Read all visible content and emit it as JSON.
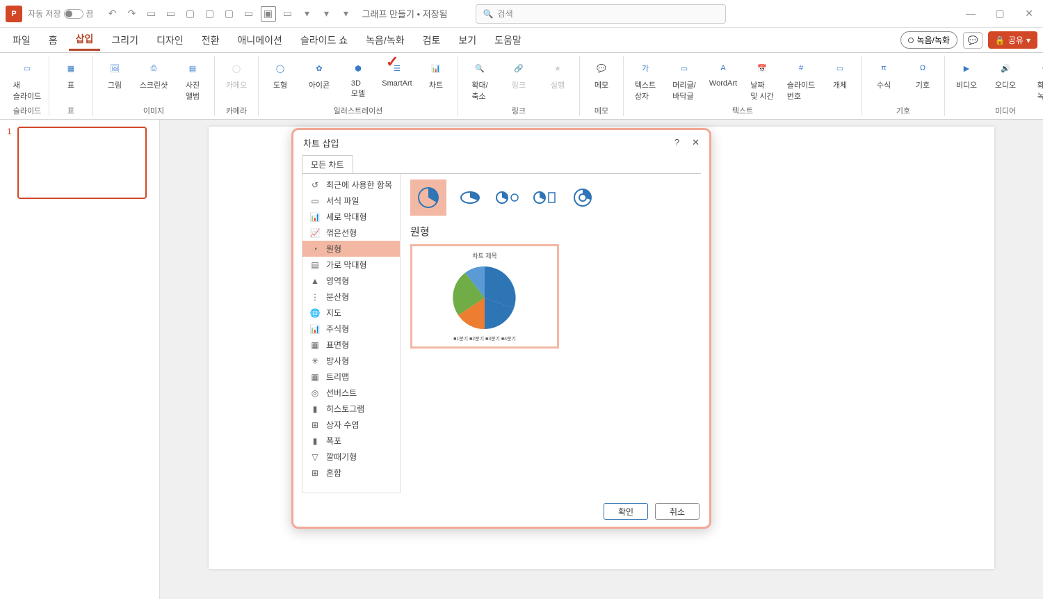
{
  "app": {
    "autosave_label": "자동 저장",
    "autosave_state": "끔",
    "doc_title": "그래프 만들기 • 저장됨",
    "search_placeholder": "검색"
  },
  "tabs": {
    "items": [
      "파일",
      "홈",
      "삽입",
      "그리기",
      "디자인",
      "전환",
      "애니메이션",
      "슬라이드 쇼",
      "녹음/녹화",
      "검토",
      "보기",
      "도움말"
    ],
    "record": "녹음/녹화",
    "share": "공유"
  },
  "ribbon": {
    "groups": [
      {
        "label": "슬라이드",
        "items": [
          {
            "name": "new-slide",
            "label": "새\n슬라이드"
          }
        ]
      },
      {
        "label": "표",
        "items": [
          {
            "name": "table",
            "label": "표"
          }
        ]
      },
      {
        "label": "이미지",
        "items": [
          {
            "name": "picture",
            "label": "그림"
          },
          {
            "name": "screenshot",
            "label": "스크린샷"
          },
          {
            "name": "photo-album",
            "label": "사진\n앨범"
          }
        ]
      },
      {
        "label": "카메라",
        "items": [
          {
            "name": "cameo",
            "label": "카메오",
            "disabled": true
          }
        ]
      },
      {
        "label": "일러스트레이션",
        "items": [
          {
            "name": "shapes",
            "label": "도형"
          },
          {
            "name": "icons",
            "label": "아이콘"
          },
          {
            "name": "3d-models",
            "label": "3D\n모델"
          },
          {
            "name": "smartart",
            "label": "SmartArt"
          },
          {
            "name": "chart",
            "label": "차트"
          }
        ]
      },
      {
        "label": "링크",
        "items": [
          {
            "name": "zoom",
            "label": "확대/\n축소"
          },
          {
            "name": "link",
            "label": "링크",
            "disabled": true
          },
          {
            "name": "action",
            "label": "실행",
            "disabled": true
          }
        ]
      },
      {
        "label": "메모",
        "items": [
          {
            "name": "comment",
            "label": "메모"
          }
        ]
      },
      {
        "label": "텍스트",
        "items": [
          {
            "name": "textbox",
            "label": "텍스트\n상자"
          },
          {
            "name": "header-footer",
            "label": "머리글/\n바닥글"
          },
          {
            "name": "wordart",
            "label": "WordArt"
          },
          {
            "name": "date-time",
            "label": "날짜\n및 시간"
          },
          {
            "name": "slide-number",
            "label": "슬라이드\n번호"
          },
          {
            "name": "object",
            "label": "개체"
          }
        ]
      },
      {
        "label": "기호",
        "items": [
          {
            "name": "equation",
            "label": "수식"
          },
          {
            "name": "symbol",
            "label": "기호"
          }
        ]
      },
      {
        "label": "미디어",
        "items": [
          {
            "name": "video",
            "label": "비디오"
          },
          {
            "name": "audio",
            "label": "오디오"
          },
          {
            "name": "screen-rec",
            "label": "화면\n녹화"
          }
        ]
      }
    ]
  },
  "slide_panel": {
    "slide_number": "1"
  },
  "dialog": {
    "title": "차트 삽입",
    "tab": "모든 차트",
    "categories": [
      {
        "id": "recent",
        "label": "최근에 사용한 항목"
      },
      {
        "id": "template",
        "label": "서식 파일"
      },
      {
        "id": "column",
        "label": "세로 막대형"
      },
      {
        "id": "line",
        "label": "꺾은선형"
      },
      {
        "id": "pie",
        "label": "원형",
        "selected": true
      },
      {
        "id": "bar",
        "label": "가로 막대형"
      },
      {
        "id": "area",
        "label": "영역형"
      },
      {
        "id": "xy",
        "label": "분산형"
      },
      {
        "id": "map",
        "label": "지도"
      },
      {
        "id": "stock",
        "label": "주식형"
      },
      {
        "id": "surface",
        "label": "표면형"
      },
      {
        "id": "radar",
        "label": "방사형"
      },
      {
        "id": "treemap",
        "label": "트리맵"
      },
      {
        "id": "sunburst",
        "label": "선버스트"
      },
      {
        "id": "histogram",
        "label": "히스토그램"
      },
      {
        "id": "boxwhisker",
        "label": "상자 수염"
      },
      {
        "id": "waterfall",
        "label": "폭포"
      },
      {
        "id": "funnel",
        "label": "깔때기형"
      },
      {
        "id": "combo",
        "label": "혼합"
      }
    ],
    "subtype_title": "원형",
    "preview": {
      "title": "차트 제목",
      "legend": "■1분기  ■2분기  ■3분기  ■4분기"
    },
    "ok": "확인",
    "cancel": "취소"
  },
  "chart_data": {
    "type": "pie",
    "title": "차트 제목",
    "categories": [
      "1분기",
      "2분기",
      "3분기",
      "4분기"
    ],
    "values": [
      45,
      25,
      15,
      15
    ],
    "colors": [
      "#2e75b6",
      "#ed7d31",
      "#a5a5a5",
      "#70ad47"
    ]
  }
}
